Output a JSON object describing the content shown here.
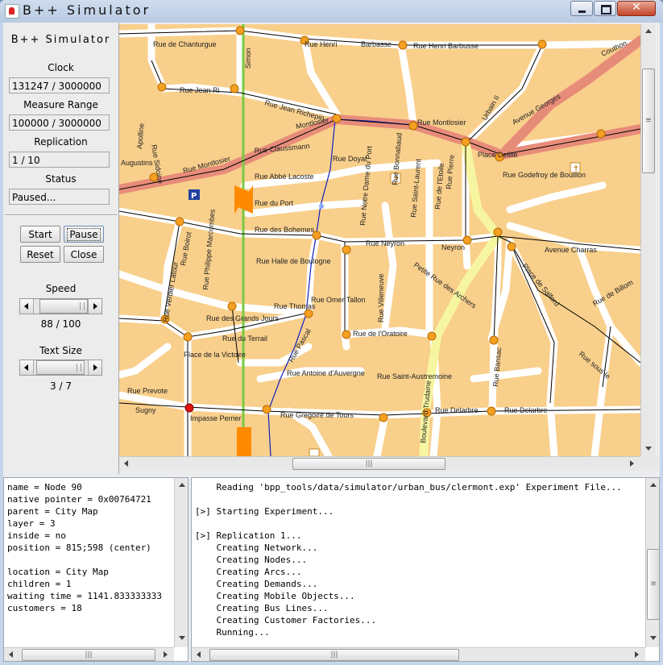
{
  "window": {
    "title": "B++ Simulator"
  },
  "sidebar": {
    "title": "B++ Simulator",
    "clock_label": "Clock",
    "clock_value": "131247 / 3000000",
    "measure_label": "Measure Range",
    "measure_value": "100000 / 3000000",
    "replication_label": "Replication",
    "replication_value": "1 / 10",
    "status_label": "Status",
    "status_value": "Paused...",
    "buttons": {
      "start": "Start",
      "pause": "Pause",
      "reset": "Reset",
      "close": "Close"
    },
    "speed_label": "Speed",
    "speed_value": "88 / 100",
    "speed_level": 0.88,
    "textsize_label": "Text Size",
    "textsize_value": "3 / 7",
    "textsize_level": 0.43
  },
  "map": {
    "streets": {
      "chanturgue": "Rue de Chanturgue",
      "henri": "Rue Henri",
      "barbasse": "Barbasse",
      "henri_barbusse": "Rue Henri Barbusse",
      "couthon": "Couthon",
      "jean_richepin_1": "Rue Jean Ri",
      "jean_richepin_2": "Rue Jean Richepin",
      "montlosier_1": "Montlosier",
      "montlosier_2": "Rue Montlosier",
      "montlosier_3": "Rue Montlosier",
      "claussmann": "Rue Claussmann",
      "abbe_lacoste": "Rue Abbé Lacoste",
      "du_port": "Rue du Port",
      "bohemes": "Rue des Bohemes",
      "halle_boulogne": "Rue Halle de Boulogne",
      "thomas": "Rue Thomas",
      "grands_jours": "Rue des Grands Jours",
      "terrail": "Rue du Terrail",
      "victoire": "Place de la Victoire",
      "antoine_auvergne": "Rue Antoine d'Auvergne",
      "gregoire_tours": "Rue Gregoire de Tours",
      "delarbre": "Rue Delarbre",
      "delarbre_2": "Rue Delarbre",
      "saint_austremoine": "Rue Saint-Austremoine",
      "godefroy": "Rue Godefroy de Bouillon",
      "charras": "Avenue Charras",
      "neyron": "Rue Neyron",
      "neyron_2": "Neyron",
      "petite_archers": "Petite Rue des Archers",
      "omer_tallon": "Rue Omer Tallon",
      "oratoire": "Rue de l'Oratoire",
      "boulevard_trudaine": "Boulevard Trudaine",
      "place_delille": "Place Delille",
      "avenue_georges": "Avenue Georges",
      "urbain": "Urbain II",
      "prevote": "Rue Prevote",
      "sugny": "Sugny",
      "impasse_perrier": "Impasse Perrier",
      "pascal": "Rue Pascal",
      "doyat": "Rue Doyat",
      "notre_dame": "Rue Notre Dame du Port",
      "bonnabaud": "Rue Bonnabaud",
      "saint_laurent": "Rue Saint-Laurent",
      "villeneuve": "Rue Villeneuve",
      "simon": "Simon",
      "verdier_latour": "Rue Verdier Latour",
      "boirot": "Rue Boirot",
      "philippe_marcombes": "Rue Philippe Marcombes",
      "etoile": "Rue de l'Etoile",
      "pierre": "Rue Pierre",
      "bansac": "Rue Bansac",
      "sous_le": "Rue sous le",
      "salford": "Place de Salford",
      "billom": "Rue de Billom",
      "augustins": "Augustins",
      "apolline": "Apolline",
      "sidoine": "Rue Sidoine"
    }
  },
  "log": {
    "inspector_lines": [
      "name = Node 90",
      "native pointer = 0x00764721",
      "parent = City Map",
      "layer = 3",
      "inside = no",
      "position = 815;598 (center)",
      "",
      "location = City Map",
      "children = 1",
      "waiting time = 1141.833333333",
      "customers = 18"
    ],
    "console_lines": [
      "    Reading 'bpp_tools/data/simulator/urban_bus/clermont.exp' Experiment File...",
      "",
      "[>] Starting Experiment...",
      "",
      "[>] Replication 1...",
      "    Creating Network...",
      "    Creating Nodes...",
      "    Creating Arcs...",
      "    Creating Demands...",
      "    Creating Mobile Objects...",
      "    Creating Bus Lines...",
      "    Creating Customer Factories...",
      "    Running..."
    ]
  },
  "colors": {
    "map_background": "#f8cf8b",
    "street": "#ffffff",
    "main_road": "#e88c7a",
    "yellow_road": "#f7f6a0",
    "node": "#f5a020",
    "selected_node": "#e01010",
    "green_line": "#7ac943",
    "bus_line": "#1020c0",
    "highlight_bus": "#ff8a00"
  }
}
